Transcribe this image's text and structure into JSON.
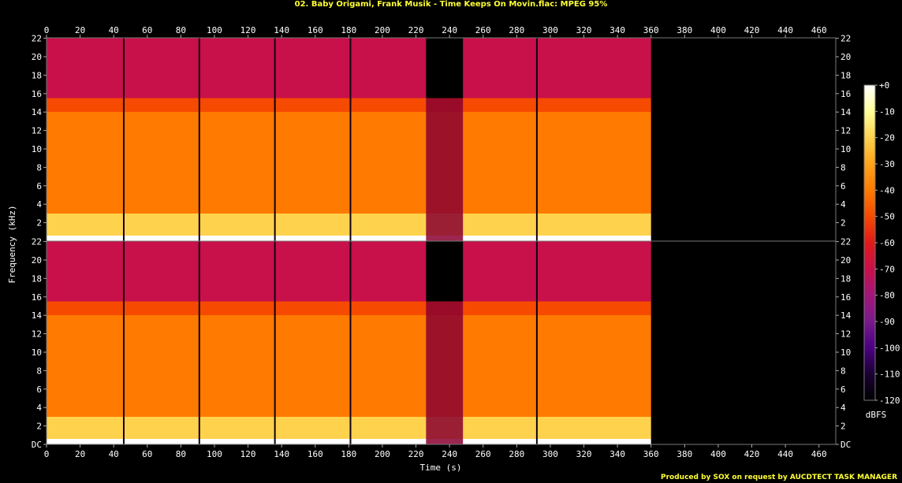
{
  "title": "02. Baby Origami, Frank Musik - Time Keeps On Movin.flac: MPEG 95%",
  "footer": "Produced by SOX on request by AUCDTECT TASK MANAGER",
  "chart_data": {
    "type": "heatmap",
    "title": "02. Baby Origami, Frank Musik - Time Keeps On Movin.flac: MPEG 95%",
    "xlabel": "Time (s)",
    "ylabel": "Frequency (kHz)",
    "x_ticks": [
      0,
      20,
      40,
      60,
      80,
      100,
      120,
      140,
      160,
      180,
      200,
      220,
      240,
      260,
      280,
      300,
      320,
      340,
      360,
      380,
      400,
      420,
      440,
      460
    ],
    "xlim": [
      0,
      470
    ],
    "y_ticks": [
      "DC",
      "2",
      "4",
      "6",
      "8",
      "10",
      "12",
      "14",
      "16",
      "18",
      "20",
      "22"
    ],
    "ylim_khz": [
      0,
      22.05
    ],
    "channels": 2,
    "colorbar": {
      "label": "dBFS",
      "ticks": [
        "+0",
        "-10",
        "-20",
        "-30",
        "-40",
        "-50",
        "-60",
        "-70",
        "-80",
        "-90",
        "-100",
        "-110",
        "-120"
      ],
      "range": [
        -120,
        0
      ],
      "colors": [
        "#000000",
        "#1a0033",
        "#4b0082",
        "#7a1a8c",
        "#a3167a",
        "#c8104a",
        "#e01a1a",
        "#f54a00",
        "#ff7a00",
        "#ffa31a",
        "#ffd24d",
        "#ffff99",
        "#ffffff"
      ]
    },
    "audio_end_s": 360,
    "cutoff_khz": 15.5,
    "quiet_section_s": [
      226,
      248
    ],
    "dropouts_s": [
      46,
      91,
      136,
      181,
      292
    ],
    "bands": [
      {
        "from_khz": 0,
        "to_khz": 0.6,
        "dbfs": -5
      },
      {
        "from_khz": 0.6,
        "to_khz": 3,
        "dbfs": -25
      },
      {
        "from_khz": 3,
        "to_khz": 14,
        "dbfs": -38
      },
      {
        "from_khz": 14,
        "to_khz": 15.5,
        "dbfs": -55
      },
      {
        "from_khz": 15.5,
        "to_khz": 22.05,
        "dbfs": -72
      }
    ]
  }
}
